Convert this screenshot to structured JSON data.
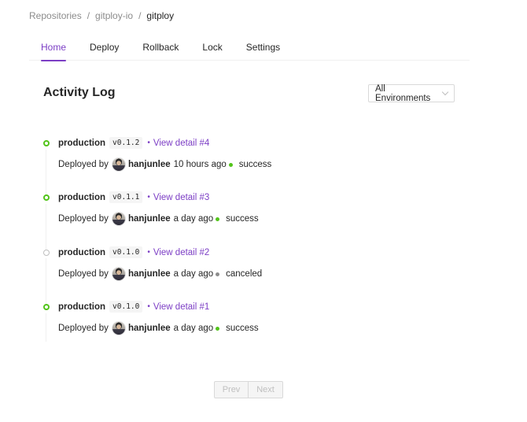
{
  "breadcrumb": {
    "items": [
      "Repositories",
      "gitploy-io",
      "gitploy"
    ],
    "separator": "/"
  },
  "tabs": [
    {
      "label": "Home",
      "active": true
    },
    {
      "label": "Deploy",
      "active": false
    },
    {
      "label": "Rollback",
      "active": false
    },
    {
      "label": "Lock",
      "active": false
    },
    {
      "label": "Settings",
      "active": false
    }
  ],
  "page": {
    "title": "Activity Log"
  },
  "filter": {
    "selected": "All Environments",
    "icon": "chevron-down-icon"
  },
  "activities": [
    {
      "environment": "production",
      "version": "v0.1.2",
      "detail_link": "View detail #4",
      "deployed_by_label": "Deployed by",
      "user": "hanjunlee",
      "time": "10 hours ago",
      "status": "success",
      "status_color": "#52c41a"
    },
    {
      "environment": "production",
      "version": "v0.1.1",
      "detail_link": "View detail #3",
      "deployed_by_label": "Deployed by",
      "user": "hanjunlee",
      "time": "a day ago",
      "status": "success",
      "status_color": "#52c41a"
    },
    {
      "environment": "production",
      "version": "v0.1.0",
      "detail_link": "View detail #2",
      "deployed_by_label": "Deployed by",
      "user": "hanjunlee",
      "time": "a day ago",
      "status": "canceled",
      "status_color": "#8c8c8c"
    },
    {
      "environment": "production",
      "version": "v0.1.0",
      "detail_link": "View detail #1",
      "deployed_by_label": "Deployed by",
      "user": "hanjunlee",
      "time": "a day ago",
      "status": "success",
      "status_color": "#52c41a"
    }
  ],
  "pagination": {
    "prev_label": "Prev",
    "next_label": "Next",
    "prev_disabled": true,
    "next_disabled": true
  },
  "colors": {
    "accent": "#7c3ec5",
    "success": "#52c41a",
    "canceled": "#bfbfbf"
  }
}
